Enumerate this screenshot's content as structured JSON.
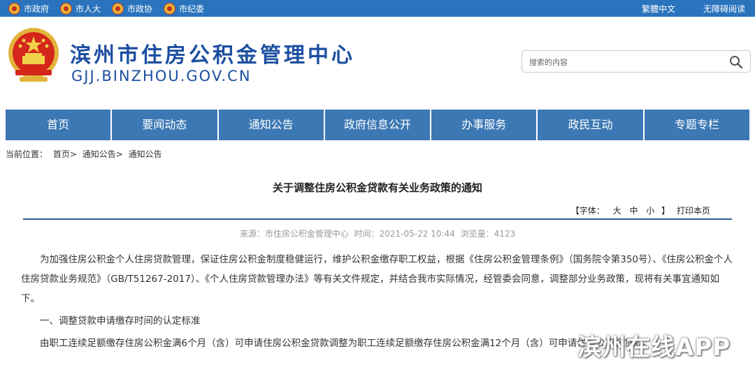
{
  "topbar": {
    "links": [
      {
        "label": "市政府",
        "icon": "national-emblem-icon"
      },
      {
        "label": "市人大",
        "icon": "national-emblem-icon"
      },
      {
        "label": "市政协",
        "icon": "national-emblem-icon"
      },
      {
        "label": "市纪委",
        "icon": "party-emblem-icon"
      }
    ],
    "traditional": "繁體中文",
    "accessible": "无障碍阅读"
  },
  "header": {
    "title": "滨州市住房公积金管理中心",
    "domain": "GJJ.BINZHOU.GOV.CN"
  },
  "search": {
    "placeholder": "搜索的内容",
    "icon": "search-icon"
  },
  "nav": [
    "首页",
    "要闻动态",
    "通知公告",
    "政府信息公开",
    "办事服务",
    "政民互动",
    "专题专栏"
  ],
  "breadcrumb": {
    "label": "当前位置：",
    "items": [
      "首页>",
      "通知公告>",
      "通知公告"
    ]
  },
  "article": {
    "title": "关于调整住房公积金贷款有关业务政策的通知",
    "font_bar": {
      "open": "【字体：",
      "large": "大",
      "medium": "中",
      "small": "小",
      "close": "】",
      "print": "打印本页"
    },
    "meta": {
      "source": "来源：市住房公积金管理中心",
      "time": "时间：2021-05-22 10:44",
      "views": "浏览量：4123"
    },
    "paragraphs": [
      "为加强住房公积金个人住房贷款管理，保证住房公积金制度稳健运行，维护公积金缴存职工权益，根据《住房公积金管理条例》（国务院令第350号）、《住房公积金个人住房贷款业务规范》（GB/T51267-2017）、《个人住房贷款管理办法》等有关文件规定，并结合我市实际情况，经管委会同意，调整部分业务政策，现将有关事宜通知如下。",
      "一、调整贷款申请缴存时间的认定标准",
      "由职工连续足额缴存住房公积金满6个月（含）可申请住房公积金贷款调整为职工连续足额缴存住房公积金满12个月（含）可申请住房公积金贷款。"
    ]
  },
  "watermark": "滨州在线APP",
  "colors": {
    "topbar": "#2a74bd",
    "nav": "#3c78b4",
    "title": "#1d4fa1"
  }
}
